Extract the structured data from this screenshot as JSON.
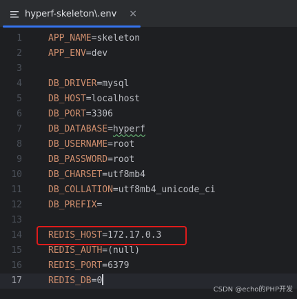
{
  "tab": {
    "title": "hyperf-skeleton\\.env",
    "close": "×"
  },
  "lines": [
    {
      "num": "1",
      "key": "APP_NAME",
      "value": "skeleton"
    },
    {
      "num": "2",
      "key": "APP_ENV",
      "value": "dev"
    },
    {
      "num": "3",
      "key": "",
      "value": ""
    },
    {
      "num": "4",
      "key": "DB_DRIVER",
      "value": "mysql"
    },
    {
      "num": "5",
      "key": "DB_HOST",
      "value": "localhost"
    },
    {
      "num": "6",
      "key": "DB_PORT",
      "value": "3306"
    },
    {
      "num": "7",
      "key": "DB_DATABASE",
      "value": "hyperf"
    },
    {
      "num": "8",
      "key": "DB_USERNAME",
      "value": "root"
    },
    {
      "num": "9",
      "key": "DB_PASSWORD",
      "value": "root"
    },
    {
      "num": "10",
      "key": "DB_CHARSET",
      "value": "utf8mb4"
    },
    {
      "num": "11",
      "key": "DB_COLLATION",
      "value": "utf8mb4_unicode_ci"
    },
    {
      "num": "12",
      "key": "DB_PREFIX",
      "value": ""
    },
    {
      "num": "13",
      "key": "",
      "value": ""
    },
    {
      "num": "14",
      "key": "REDIS_HOST",
      "value": "172.17.0.3"
    },
    {
      "num": "15",
      "key": "REDIS_AUTH",
      "value": "(null)"
    },
    {
      "num": "16",
      "key": "REDIS_PORT",
      "value": "6379"
    },
    {
      "num": "17",
      "key": "REDIS_DB",
      "value": "0"
    }
  ],
  "current_line": "17",
  "watermark": "CSDN @echo的PHP开发",
  "colors": {
    "accent": "#3574f0",
    "key": "#cf8e6d",
    "highlight": "#e01b1b"
  }
}
